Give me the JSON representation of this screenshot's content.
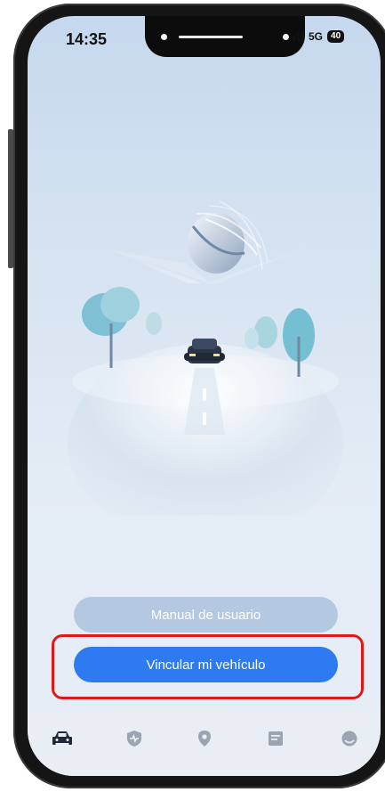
{
  "status_bar": {
    "time": "14:35",
    "network": "5G",
    "battery": "40"
  },
  "buttons": {
    "manual_label": "Manual de usuario",
    "link_label": "Vincular mi vehículo"
  },
  "tab_bar": {
    "tabs": [
      {
        "icon": "car-icon",
        "active": true
      },
      {
        "icon": "shield-heart-icon",
        "active": false
      },
      {
        "icon": "location-pin-icon",
        "active": false
      },
      {
        "icon": "message-icon",
        "active": false
      },
      {
        "icon": "profile-icon",
        "active": false
      }
    ]
  },
  "colors": {
    "primary_button": "#2e7af0",
    "secondary_button": "#b4c8e2",
    "highlight_border": "#e01818",
    "tab_active": "#1f2937",
    "tab_inactive": "#9aa4b2"
  }
}
